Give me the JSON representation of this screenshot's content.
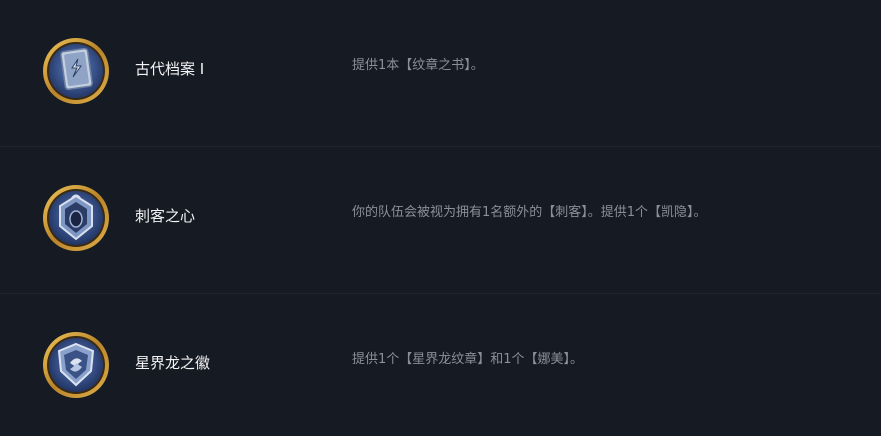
{
  "augments": [
    {
      "name": "古代档案 I",
      "description": "提供1本【纹章之书】。",
      "icon": "book-icon"
    },
    {
      "name": "刺客之心",
      "description": "你的队伍会被视为拥有1名额外的【刺客】。提供1个【凯隐】。",
      "icon": "assassin-crest-icon"
    },
    {
      "name": "星界龙之徽",
      "description": "提供1个【星界龙纹章】和1个【娜美】。",
      "icon": "astral-crest-icon"
    }
  ],
  "colors": {
    "background": "#161a22",
    "divider": "#20242d",
    "name_text": "#f2f3f5",
    "desc_text": "#8b8f98",
    "frame_gold": "#c9962e",
    "icon_blue": "#3d5c9e"
  }
}
